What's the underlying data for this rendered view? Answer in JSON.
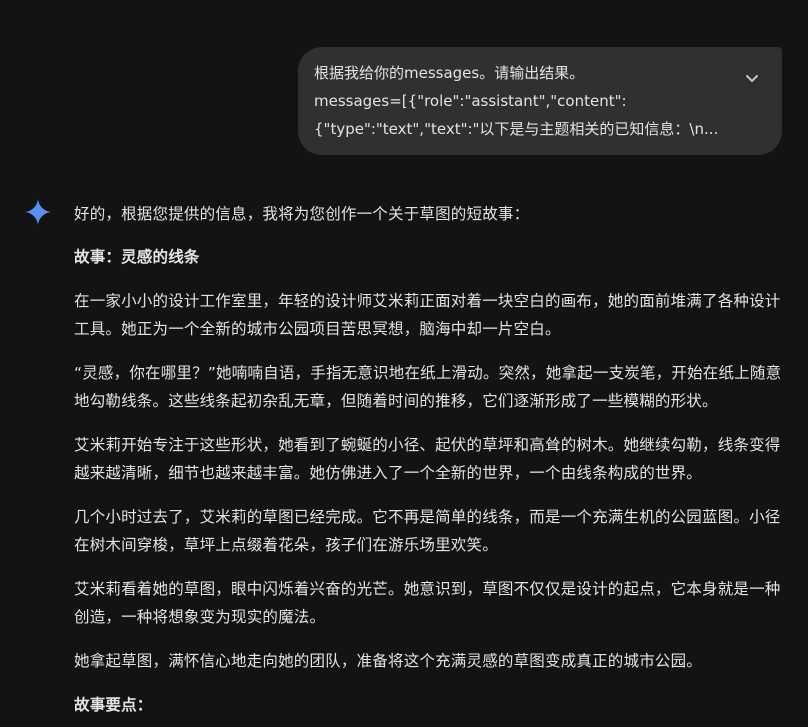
{
  "user_message": {
    "line1": "根据我给你的messages。请输出结果。",
    "line2": "messages=[{\"role\":\"assistant\",\"content\":",
    "line3": "{\"type\":\"text\",\"text\":\"以下是与主题相关的已知信息：\\n..."
  },
  "expand_icon": "chevron-down-icon",
  "assistant_icon": "gemini-sparkle-icon",
  "colors": {
    "background": "#131314",
    "bubble": "#2f3031",
    "text": "#e3e3e3",
    "sparkle_blue": "#4c8df6"
  },
  "response": {
    "intro": "好的，根据您提供的信息，我将为您创作一个关于草图的短故事：",
    "title": "故事：灵感的线条",
    "paragraphs": [
      "在一家小小的设计工作室里，年轻的设计师艾米莉正面对着一块空白的画布，她的面前堆满了各种设计工具。她正为一个全新的城市公园项目苦思冥想，脑海中却一片空白。",
      "“灵感，你在哪里？”她喃喃自语，手指无意识地在纸上滑动。突然，她拿起一支炭笔，开始在纸上随意地勾勒线条。这些线条起初杂乱无章，但随着时间的推移，它们逐渐形成了一些模糊的形状。",
      "艾米莉开始专注于这些形状，她看到了蜿蜒的小径、起伏的草坪和高耸的树木。她继续勾勒，线条变得越来越清晰，细节也越来越丰富。她仿佛进入了一个全新的世界，一个由线条构成的世界。",
      "几个小时过去了，艾米莉的草图已经完成。它不再是简单的线条，而是一个充满生机的公园蓝图。小径在树木间穿梭，草坪上点缀着花朵，孩子们在游乐场里欢笑。",
      "艾米莉看着她的草图，眼中闪烁着兴奋的光芒。她意识到，草图不仅仅是设计的起点，它本身就是一种创造，一种将想象变为现实的魔法。",
      "她拿起草图，满怀信心地走向她的团队，准备将这个充满灵感的草图变成真正的城市公园。"
    ],
    "points_title": "故事要点："
  }
}
